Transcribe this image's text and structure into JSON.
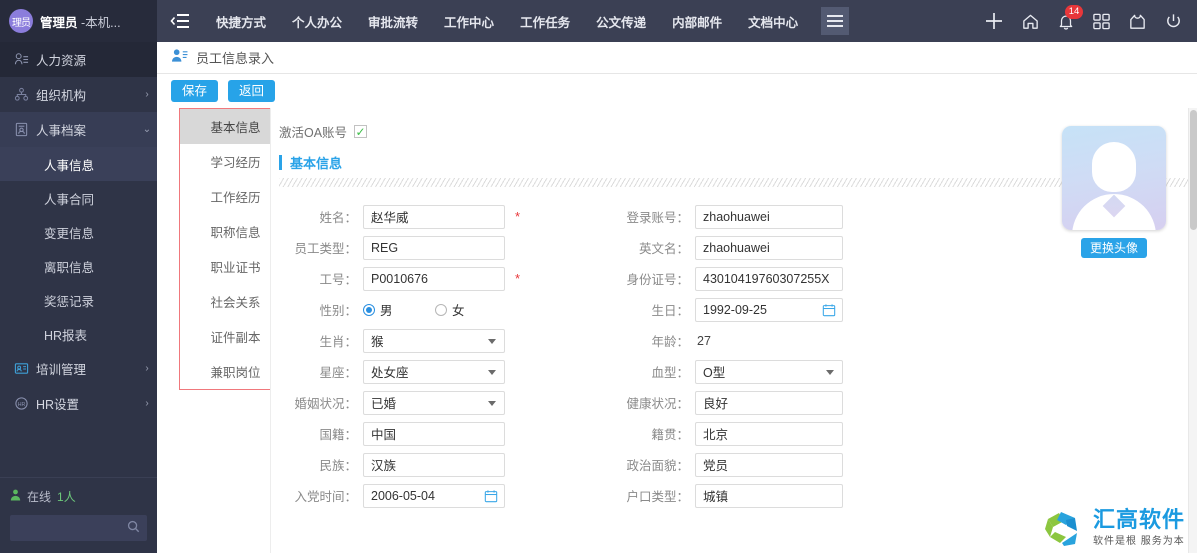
{
  "colors": {
    "sidebar_bg": "#2f3447",
    "topbar_bg": "#3b4054",
    "accent": "#27a3e8",
    "required_star": "#e8373a",
    "tab_border": "#f0787c",
    "online_green": "#6cc77a",
    "logo_blue": "#1b9ae0"
  },
  "sidebar": {
    "user": {
      "avatar_text": "理员",
      "name": "管理员",
      "suffix": " -本机..."
    },
    "items": [
      {
        "label": "人力资源",
        "icon": "user-list-icon",
        "level": 0,
        "state": "active-dark",
        "arrow": ""
      },
      {
        "label": "组织机构",
        "icon": "org-tree-icon",
        "level": 0,
        "state": "normal",
        "arrow": "›"
      },
      {
        "label": "人事档案",
        "icon": "personnel-file-icon",
        "level": 0,
        "state": "open",
        "arrow": "⌄"
      },
      {
        "label": "人事信息",
        "icon": "",
        "level": 1,
        "state": "current",
        "arrow": ""
      },
      {
        "label": "人事合同",
        "icon": "",
        "level": 1,
        "state": "normal",
        "arrow": ""
      },
      {
        "label": "变更信息",
        "icon": "",
        "level": 1,
        "state": "normal",
        "arrow": ""
      },
      {
        "label": "离职信息",
        "icon": "",
        "level": 1,
        "state": "normal",
        "arrow": ""
      },
      {
        "label": "奖惩记录",
        "icon": "",
        "level": 1,
        "state": "normal",
        "arrow": ""
      },
      {
        "label": "HR报表",
        "icon": "",
        "level": 1,
        "state": "normal",
        "arrow": ""
      },
      {
        "label": "培训管理",
        "icon": "training-card-icon",
        "level": 0,
        "state": "normal",
        "arrow": "›"
      },
      {
        "label": "HR设置",
        "icon": "hr-settings-icon",
        "level": 0,
        "state": "normal",
        "arrow": "›"
      }
    ],
    "footer": {
      "online_label": "在线",
      "online_count": "1人",
      "search_placeholder": ""
    }
  },
  "topbar": {
    "menu_icon": "list-collapse-icon",
    "links": [
      "快捷方式",
      "个人办公",
      "审批流转",
      "工作中心",
      "工作任务",
      "公文传递",
      "内部邮件",
      "文档中心"
    ],
    "grid_button": "hamburger-button",
    "right_icons": [
      {
        "name": "add-icon",
        "glyph": "+"
      },
      {
        "name": "home-icon",
        "glyph": "⌂"
      },
      {
        "name": "bell-icon",
        "glyph": "bell",
        "badge": "14"
      },
      {
        "name": "apps-icon",
        "glyph": "apps"
      },
      {
        "name": "shirt-icon",
        "glyph": "shirt"
      },
      {
        "name": "power-icon",
        "glyph": "power"
      }
    ]
  },
  "breadcrumb": {
    "icon": "user-card-icon",
    "title": "员工信息录入"
  },
  "actions": {
    "save": "保存",
    "back": "返回"
  },
  "tabs": [
    {
      "label": "基本信息",
      "active": true
    },
    {
      "label": "学习经历",
      "active": false
    },
    {
      "label": "工作经历",
      "active": false
    },
    {
      "label": "职称信息",
      "active": false
    },
    {
      "label": "职业证书",
      "active": false
    },
    {
      "label": "社会关系",
      "active": false
    },
    {
      "label": "证件副本",
      "active": false
    },
    {
      "label": "兼职岗位",
      "active": false
    }
  ],
  "form": {
    "oa_label": "激活OA账号",
    "oa_checked": "✓",
    "section_title": "基本信息",
    "left_fields": [
      {
        "label": "姓名：",
        "value": "赵华威",
        "type": "text",
        "required": true
      },
      {
        "label": "员工类型：",
        "value": "REG",
        "type": "text",
        "required": false
      },
      {
        "label": "工号：",
        "value": "P0010676",
        "type": "text",
        "required": true
      },
      {
        "label": "性别：",
        "type": "radio",
        "options": [
          "男",
          "女"
        ],
        "selected": "男"
      },
      {
        "label": "生肖：",
        "value": "猴",
        "type": "select",
        "required": false
      },
      {
        "label": "星座：",
        "value": "处女座",
        "type": "select",
        "required": false
      },
      {
        "label": "婚姻状况：",
        "value": "已婚",
        "type": "select",
        "required": false
      },
      {
        "label": "国籍：",
        "value": "中国",
        "type": "text",
        "required": false
      },
      {
        "label": "民族：",
        "value": "汉族",
        "type": "text",
        "required": false
      },
      {
        "label": "入党时间：",
        "value": "2006-05-04",
        "type": "date",
        "required": false
      }
    ],
    "right_fields": [
      {
        "label": "登录账号：",
        "value": "zhaohuawei",
        "type": "text",
        "required": false
      },
      {
        "label": "英文名：",
        "value": "zhaohuawei",
        "type": "text",
        "required": false
      },
      {
        "label": "身份证号：",
        "value": "43010419760307255X",
        "type": "text",
        "required": false
      },
      {
        "label": "生日：",
        "value": "1992-09-25",
        "type": "date",
        "required": false
      },
      {
        "label": "年龄：",
        "value": "27",
        "type": "plain",
        "required": false
      },
      {
        "label": "血型：",
        "value": "O型",
        "type": "select",
        "required": false
      },
      {
        "label": "健康状况：",
        "value": "良好",
        "type": "text",
        "required": false
      },
      {
        "label": "籍贯：",
        "value": "北京",
        "type": "text",
        "required": false
      },
      {
        "label": "政治面貌：",
        "value": "党员",
        "type": "text",
        "required": false
      },
      {
        "label": "户口类型：",
        "value": "城镇",
        "type": "text",
        "required": false
      }
    ]
  },
  "avatar_panel": {
    "change_button": "更换头像"
  },
  "logo": {
    "name": "汇高软件",
    "tagline": "软件是根 服务为本"
  }
}
